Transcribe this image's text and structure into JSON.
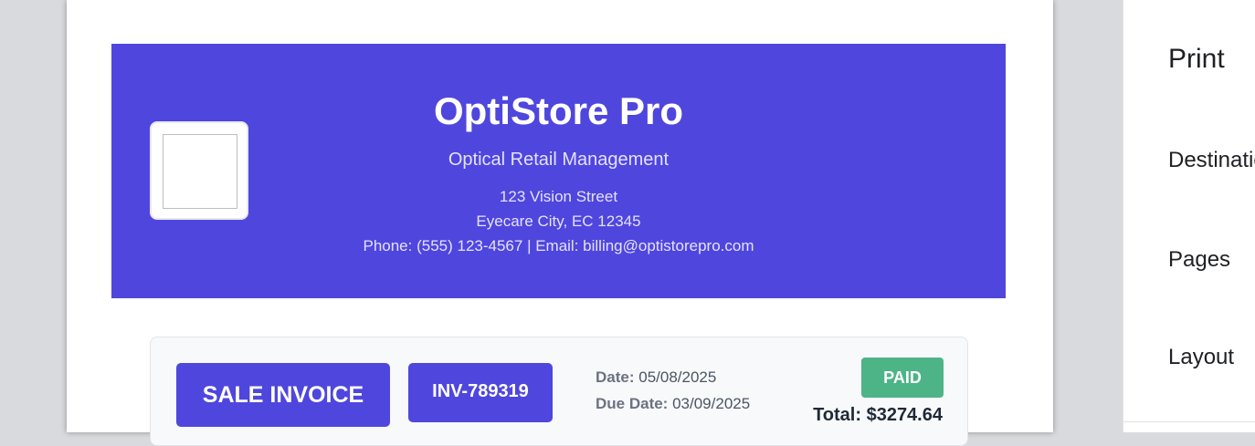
{
  "invoice": {
    "company": {
      "name": "OptiStore Pro",
      "tagline": "Optical Retail Management",
      "address_line1": "123 Vision Street",
      "address_line2": "Eyecare City, EC 12345",
      "contact": "Phone: (555) 123-4567 | Email: billing@optistorepro.com"
    },
    "header": {
      "type_label": "SALE INVOICE",
      "number": "INV-789319",
      "date_label": "Date:",
      "date_value": "05/08/2025",
      "due_label": "Due Date:",
      "due_value": "03/09/2025",
      "status": "PAID",
      "total": "Total: $3274.64"
    }
  },
  "print_panel": {
    "title": "Print",
    "destination_label": "Destination",
    "pages_label": "Pages",
    "layout_label": "Layout"
  },
  "colors": {
    "brand": "#4f46de",
    "paid": "#4db487",
    "backdrop": "#d9dadd"
  }
}
